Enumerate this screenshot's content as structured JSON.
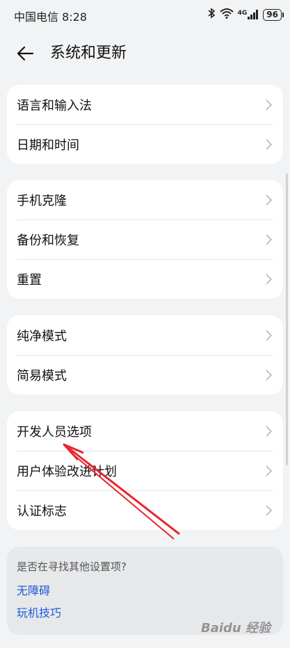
{
  "status_bar": {
    "carrier_time": "中国电信 8:28",
    "network": "4G",
    "battery": "96"
  },
  "header": {
    "title": "系统和更新"
  },
  "groups": [
    {
      "items": [
        {
          "label": "语言和输入法"
        },
        {
          "label": "日期和时间"
        }
      ]
    },
    {
      "items": [
        {
          "label": "手机克隆"
        },
        {
          "label": "备份和恢复"
        },
        {
          "label": "重置"
        }
      ]
    },
    {
      "items": [
        {
          "label": "纯净模式"
        },
        {
          "label": "简易模式"
        }
      ]
    },
    {
      "items": [
        {
          "label": "开发人员选项"
        },
        {
          "label": "用户体验改进计划"
        },
        {
          "label": "认证标志"
        }
      ]
    }
  ],
  "hint": {
    "title": "是否在寻找其他设置项?",
    "links": [
      "无障碍",
      "玩机技巧"
    ]
  },
  "annotation": {
    "color": "#e8262e"
  },
  "watermark": "Baidu 经验"
}
